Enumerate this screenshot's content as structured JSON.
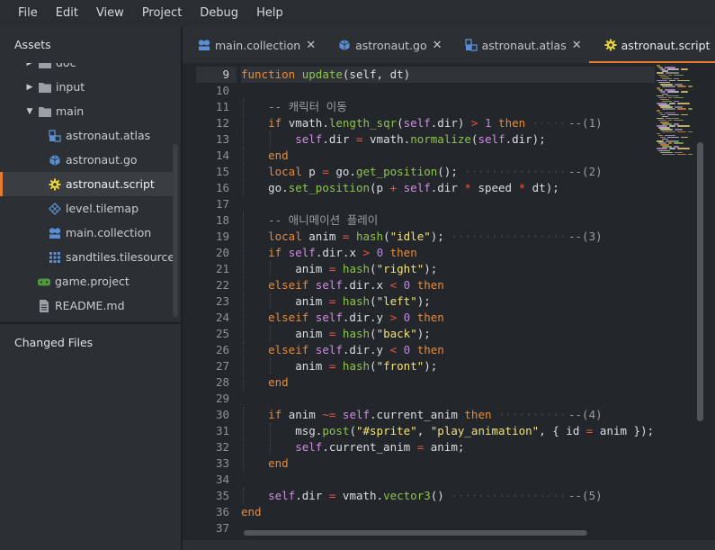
{
  "menu": [
    "File",
    "Edit",
    "View",
    "Project",
    "Debug",
    "Help"
  ],
  "assets_title": "Assets",
  "changed_files_title": "Changed Files",
  "tree": [
    {
      "label": "doc",
      "kind": "folder",
      "arrow": "right",
      "icon": "folder-icon"
    },
    {
      "label": "input",
      "kind": "folder",
      "arrow": "right",
      "icon": "folder-icon"
    },
    {
      "label": "main",
      "kind": "folder",
      "arrow": "down",
      "icon": "folder-open-icon"
    },
    {
      "label": "astronaut.atlas",
      "kind": "file",
      "icon": "atlas-icon"
    },
    {
      "label": "astronaut.go",
      "kind": "file",
      "icon": "gameobject-icon"
    },
    {
      "label": "astronaut.script",
      "kind": "file",
      "icon": "script-gear-icon",
      "selected": true
    },
    {
      "label": "level.tilemap",
      "kind": "file",
      "icon": "tilemap-icon"
    },
    {
      "label": "main.collection",
      "kind": "file",
      "icon": "collection-icon"
    },
    {
      "label": "sandtiles.tilesource",
      "kind": "file",
      "icon": "tilesource-icon"
    },
    {
      "label": "game.project",
      "kind": "root-file",
      "icon": "game-project-icon"
    },
    {
      "label": "README.md",
      "kind": "root-file",
      "icon": "document-icon"
    }
  ],
  "tabs": [
    {
      "label": "main.collection",
      "icon": "collection-icon"
    },
    {
      "label": "astronaut.go",
      "icon": "gameobject-icon"
    },
    {
      "label": "astronaut.atlas",
      "icon": "atlas-icon"
    },
    {
      "label": "astronaut.script",
      "icon": "script-gear-icon",
      "active": true
    }
  ],
  "colors": {
    "accent": "#e97a2d",
    "keyword": "#e78b3c",
    "function": "#8fc34f",
    "string": "#f0e27a",
    "number": "#b58bd6",
    "operator": "#e4574a",
    "self": "#d08de3"
  },
  "current_line": 9,
  "code_lines": [
    {
      "n": "9",
      "indent": 0,
      "tokens": [
        [
          "kw",
          "function"
        ],
        [
          "t",
          " "
        ],
        [
          "fn",
          "update"
        ],
        [
          "t",
          "(self, dt)"
        ]
      ]
    },
    {
      "n": "10",
      "indent": 0,
      "tokens": []
    },
    {
      "n": "11",
      "indent": 1,
      "tokens": [
        [
          "cmt",
          "-- 캐릭터 이동"
        ]
      ]
    },
    {
      "n": "12",
      "indent": 1,
      "tokens": [
        [
          "kw",
          "if"
        ],
        [
          "t",
          " vmath."
        ],
        [
          "fn",
          "length_sqr"
        ],
        [
          "t",
          "("
        ],
        [
          "self",
          "self"
        ],
        [
          "t",
          ".dir) "
        ],
        [
          "op",
          ">"
        ],
        [
          "t",
          " "
        ],
        [
          "num",
          "1"
        ],
        [
          "t",
          " "
        ],
        [
          "kw",
          "then"
        ]
      ],
      "note": "--(1)"
    },
    {
      "n": "13",
      "indent": 2,
      "tokens": [
        [
          "self",
          "self"
        ],
        [
          "t",
          ".dir "
        ],
        [
          "op",
          "="
        ],
        [
          "t",
          " vmath."
        ],
        [
          "fn",
          "normalize"
        ],
        [
          "t",
          "("
        ],
        [
          "self",
          "self"
        ],
        [
          "t",
          ".dir);"
        ]
      ]
    },
    {
      "n": "14",
      "indent": 1,
      "tokens": [
        [
          "kw",
          "end"
        ]
      ]
    },
    {
      "n": "15",
      "indent": 1,
      "tokens": [
        [
          "kw",
          "local"
        ],
        [
          "t",
          " p "
        ],
        [
          "op",
          "="
        ],
        [
          "t",
          " go."
        ],
        [
          "fn",
          "get_position"
        ],
        [
          "t",
          "();"
        ]
      ],
      "note": "--(2)"
    },
    {
      "n": "16",
      "indent": 1,
      "tokens": [
        [
          "t",
          "go."
        ],
        [
          "fn",
          "set_position"
        ],
        [
          "t",
          "(p "
        ],
        [
          "op",
          "+"
        ],
        [
          "t",
          " "
        ],
        [
          "self",
          "self"
        ],
        [
          "t",
          ".dir "
        ],
        [
          "op",
          "*"
        ],
        [
          "t",
          " speed "
        ],
        [
          "op",
          "*"
        ],
        [
          "t",
          " dt);"
        ]
      ]
    },
    {
      "n": "17",
      "indent": 0,
      "tokens": []
    },
    {
      "n": "18",
      "indent": 1,
      "tokens": [
        [
          "cmt",
          "-- 애니메이션 플레이"
        ]
      ]
    },
    {
      "n": "19",
      "indent": 1,
      "tokens": [
        [
          "kw",
          "local"
        ],
        [
          "t",
          " anim "
        ],
        [
          "op",
          "="
        ],
        [
          "t",
          " "
        ],
        [
          "fn",
          "hash"
        ],
        [
          "t",
          "("
        ],
        [
          "str",
          "\"idle\""
        ],
        [
          "t",
          ");"
        ]
      ],
      "note": "--(3)"
    },
    {
      "n": "20",
      "indent": 1,
      "tokens": [
        [
          "kw",
          "if"
        ],
        [
          "t",
          " "
        ],
        [
          "self",
          "self"
        ],
        [
          "t",
          ".dir.x "
        ],
        [
          "op",
          ">"
        ],
        [
          "t",
          " "
        ],
        [
          "num",
          "0"
        ],
        [
          "t",
          " "
        ],
        [
          "kw",
          "then"
        ]
      ]
    },
    {
      "n": "21",
      "indent": 2,
      "tokens": [
        [
          "t",
          "anim "
        ],
        [
          "op",
          "="
        ],
        [
          "t",
          " "
        ],
        [
          "fn",
          "hash"
        ],
        [
          "t",
          "("
        ],
        [
          "str",
          "\"right\""
        ],
        [
          "t",
          ");"
        ]
      ]
    },
    {
      "n": "22",
      "indent": 1,
      "tokens": [
        [
          "kw",
          "elseif"
        ],
        [
          "t",
          " "
        ],
        [
          "self",
          "self"
        ],
        [
          "t",
          ".dir.x "
        ],
        [
          "op",
          "<"
        ],
        [
          "t",
          " "
        ],
        [
          "num",
          "0"
        ],
        [
          "t",
          " "
        ],
        [
          "kw",
          "then"
        ]
      ]
    },
    {
      "n": "23",
      "indent": 2,
      "tokens": [
        [
          "t",
          "anim "
        ],
        [
          "op",
          "="
        ],
        [
          "t",
          " "
        ],
        [
          "fn",
          "hash"
        ],
        [
          "t",
          "("
        ],
        [
          "str",
          "\"left\""
        ],
        [
          "t",
          ");"
        ]
      ]
    },
    {
      "n": "24",
      "indent": 1,
      "tokens": [
        [
          "kw",
          "elseif"
        ],
        [
          "t",
          " "
        ],
        [
          "self",
          "self"
        ],
        [
          "t",
          ".dir.y "
        ],
        [
          "op",
          ">"
        ],
        [
          "t",
          " "
        ],
        [
          "num",
          "0"
        ],
        [
          "t",
          " "
        ],
        [
          "kw",
          "then"
        ]
      ]
    },
    {
      "n": "25",
      "indent": 2,
      "tokens": [
        [
          "t",
          "anim "
        ],
        [
          "op",
          "="
        ],
        [
          "t",
          " "
        ],
        [
          "fn",
          "hash"
        ],
        [
          "t",
          "("
        ],
        [
          "str",
          "\"back\""
        ],
        [
          "t",
          ");"
        ]
      ]
    },
    {
      "n": "26",
      "indent": 1,
      "tokens": [
        [
          "kw",
          "elseif"
        ],
        [
          "t",
          " "
        ],
        [
          "self",
          "self"
        ],
        [
          "t",
          ".dir.y "
        ],
        [
          "op",
          "<"
        ],
        [
          "t",
          " "
        ],
        [
          "num",
          "0"
        ],
        [
          "t",
          " "
        ],
        [
          "kw",
          "then"
        ]
      ]
    },
    {
      "n": "27",
      "indent": 2,
      "tokens": [
        [
          "t",
          "anim "
        ],
        [
          "op",
          "="
        ],
        [
          "t",
          " "
        ],
        [
          "fn",
          "hash"
        ],
        [
          "t",
          "("
        ],
        [
          "str",
          "\"front\""
        ],
        [
          "t",
          ");"
        ]
      ]
    },
    {
      "n": "28",
      "indent": 1,
      "tokens": [
        [
          "kw",
          "end"
        ]
      ]
    },
    {
      "n": "29",
      "indent": 0,
      "tokens": []
    },
    {
      "n": "30",
      "indent": 1,
      "tokens": [
        [
          "kw",
          "if"
        ],
        [
          "t",
          " anim "
        ],
        [
          "op",
          "~="
        ],
        [
          "t",
          " "
        ],
        [
          "self",
          "self"
        ],
        [
          "t",
          ".current_anim "
        ],
        [
          "kw",
          "then"
        ]
      ],
      "note": "--(4)"
    },
    {
      "n": "31",
      "indent": 2,
      "tokens": [
        [
          "t",
          "msg."
        ],
        [
          "fn",
          "post"
        ],
        [
          "t",
          "("
        ],
        [
          "str",
          "\"#sprite\""
        ],
        [
          "t",
          ", "
        ],
        [
          "str",
          "\"play_animation\""
        ],
        [
          "t",
          ", { id "
        ],
        [
          "op",
          "="
        ],
        [
          "t",
          " anim });"
        ]
      ]
    },
    {
      "n": "32",
      "indent": 2,
      "tokens": [
        [
          "self",
          "self"
        ],
        [
          "t",
          ".current_anim "
        ],
        [
          "op",
          "="
        ],
        [
          "t",
          " anim;"
        ]
      ]
    },
    {
      "n": "33",
      "indent": 1,
      "tokens": [
        [
          "kw",
          "end"
        ]
      ]
    },
    {
      "n": "34",
      "indent": 0,
      "tokens": []
    },
    {
      "n": "35",
      "indent": 1,
      "tokens": [
        [
          "self",
          "self"
        ],
        [
          "t",
          ".dir "
        ],
        [
          "op",
          "="
        ],
        [
          "t",
          " vmath."
        ],
        [
          "fn",
          "vector3"
        ],
        [
          "t",
          "()"
        ]
      ],
      "note": "--(5)"
    },
    {
      "n": "36",
      "indent": 0,
      "tokens": [
        [
          "kw",
          "end"
        ]
      ]
    },
    {
      "n": "37",
      "indent": 0,
      "tokens": []
    }
  ]
}
